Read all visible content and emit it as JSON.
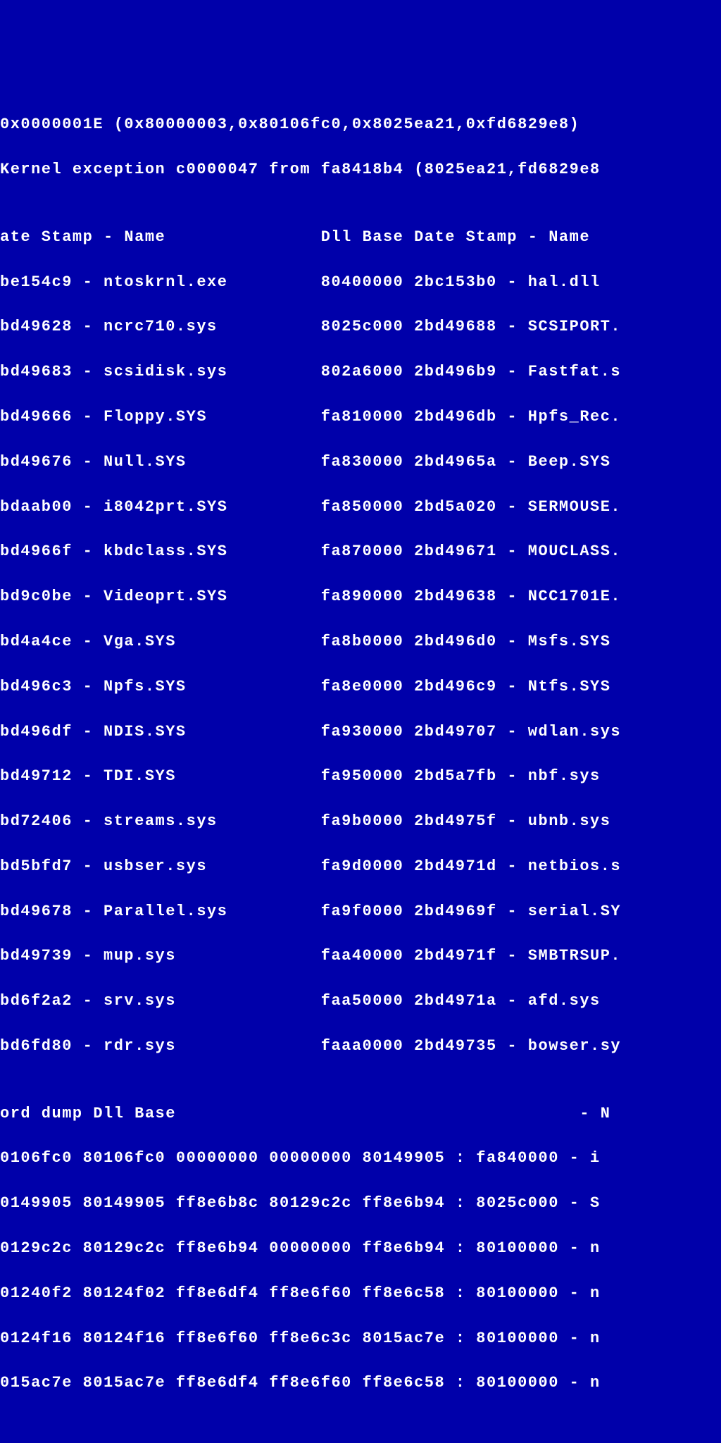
{
  "lines": [
    "0x0000001E (0x80000003,0x80106fc0,0x8025ea21,0xfd6829e8)",
    "Kernel exception c0000047 from fa8418b4 (8025ea21,fd6829e8",
    "",
    "ate Stamp - Name               Dll Base Date Stamp - Name",
    "be154c9 - ntoskrnl.exe         80400000 2bc153b0 - hal.dll",
    "bd49628 - ncrc710.sys          8025c000 2bd49688 - SCSIPORT.",
    "bd49683 - scsidisk.sys         802a6000 2bd496b9 - Fastfat.s",
    "bd49666 - Floppy.SYS           fa810000 2bd496db - Hpfs_Rec.",
    "bd49676 - Null.SYS             fa830000 2bd4965a - Beep.SYS",
    "bdaab00 - i8042prt.SYS         fa850000 2bd5a020 - SERMOUSE.",
    "bd4966f - kbdclass.SYS         fa870000 2bd49671 - MOUCLASS.",
    "bd9c0be - Videoprt.SYS         fa890000 2bd49638 - NCC1701E.",
    "bd4a4ce - Vga.SYS              fa8b0000 2bd496d0 - Msfs.SYS",
    "bd496c3 - Npfs.SYS             fa8e0000 2bd496c9 - Ntfs.SYS",
    "bd496df - NDIS.SYS             fa930000 2bd49707 - wdlan.sys",
    "bd49712 - TDI.SYS              fa950000 2bd5a7fb - nbf.sys",
    "bd72406 - streams.sys          fa9b0000 2bd4975f - ubnb.sys",
    "bd5bfd7 - usbser.sys           fa9d0000 2bd4971d - netbios.s",
    "bd49678 - Parallel.sys         fa9f0000 2bd4969f - serial.SY",
    "bd49739 - mup.sys              faa40000 2bd4971f - SMBTRSUP.",
    "bd6f2a2 - srv.sys              faa50000 2bd4971a - afd.sys",
    "bd6fd80 - rdr.sys              faaa0000 2bd49735 - bowser.sy",
    "",
    "ord dump Dll Base                                       - N",
    "0106fc0 80106fc0 00000000 00000000 80149905 : fa840000 - i",
    "0149905 80149905 ff8e6b8c 80129c2c ff8e6b94 : 8025c000 - S",
    "0129c2c 80129c2c ff8e6b94 00000000 ff8e6b94 : 80100000 - n",
    "01240f2 80124f02 ff8e6df4 ff8e6f60 ff8e6c58 : 80100000 - n",
    "0124f16 80124f16 ff8e6f60 ff8e6c3c 8015ac7e : 80100000 - n",
    "015ac7e 8015ac7e ff8e6df4 ff8e6f60 ff8e6c58 : 80100000 - n"
  ]
}
